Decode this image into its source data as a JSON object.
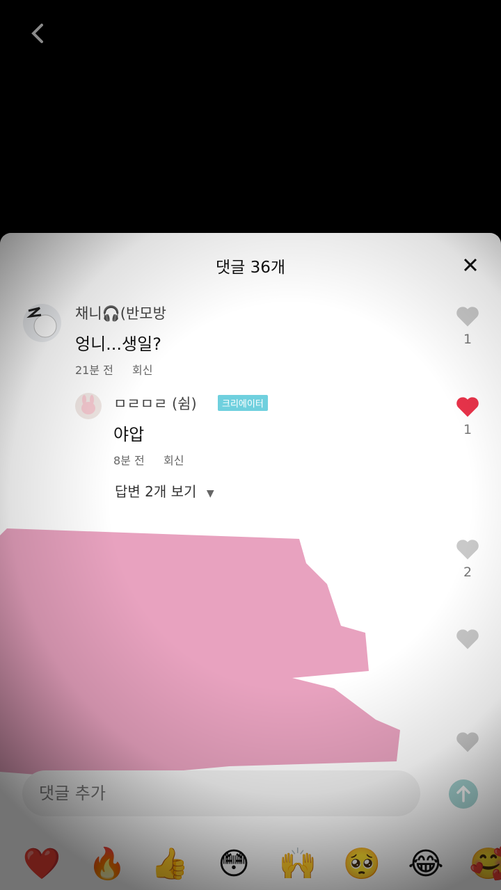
{
  "nav": {
    "back_icon": "chevron-left-icon"
  },
  "sheet": {
    "title": "댓글 36개",
    "close_icon": "close-icon"
  },
  "comments": [
    {
      "username": "채니🎧(반모방",
      "text": "엉니...생일?",
      "time": "21분 전",
      "reply_label": "회신",
      "likes": "1",
      "liked": false
    },
    {
      "username": "ㅁㄹㅁㄹ (쉼)",
      "badge": "크리에이터",
      "text": "야압",
      "time": "8분 전",
      "reply_label": "회신",
      "likes": "1",
      "liked": true
    }
  ],
  "view_replies": "답변 2개 보기",
  "hidden_likes": [
    "2",
    "",
    ""
  ],
  "input": {
    "placeholder": "댓글 추가"
  },
  "colors": {
    "liked": "#e8334a",
    "unliked": "#c9c9c9",
    "badge": "#6fd0de",
    "send": "#a6d6d4",
    "redaction": "#e8a2bf"
  },
  "emoji_bar": [
    "❤️",
    "🔥",
    "👍",
    "😳",
    "🙌",
    "🥺",
    "😂",
    "🥰"
  ]
}
